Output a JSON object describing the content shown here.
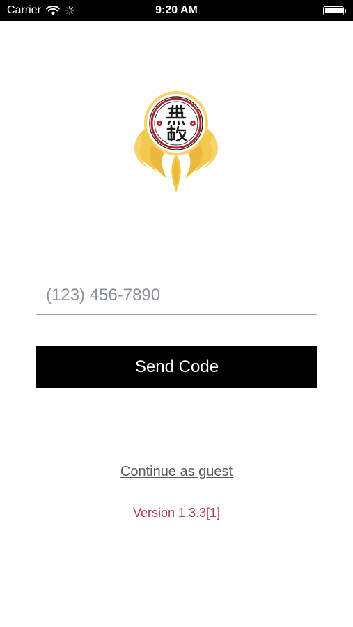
{
  "status_bar": {
    "carrier": "Carrier",
    "time": "9:20 AM"
  },
  "login": {
    "phone_placeholder": "(123) 456-7890",
    "phone_value": "",
    "send_code_label": "Send Code",
    "guest_label": "Continue as guest",
    "version_text": "Version 1.3.3[1]"
  },
  "colors": {
    "button_bg": "#000000",
    "button_text": "#ffffff",
    "version_text": "#b03a63",
    "guest_link": "#5a5a5a",
    "logo_gold": "#f2c94c",
    "logo_red": "#c0202e"
  }
}
